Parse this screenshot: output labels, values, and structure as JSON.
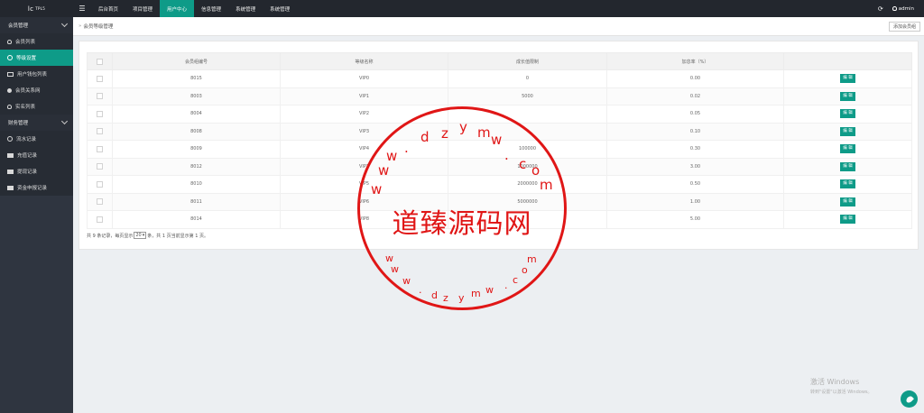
{
  "app": {
    "logo": "lc",
    "logo_sup": "TPL5"
  },
  "topnav": {
    "items": [
      "后台首页",
      "项目管理",
      "用户中心",
      "信息管理",
      "系统管理",
      "系统管理"
    ],
    "active_index": 2,
    "user": "admin"
  },
  "sidebar": {
    "groups": [
      {
        "label": "会员管理",
        "items": [
          {
            "label": "会员列表",
            "icon": "user-icon"
          },
          {
            "label": "等级设置",
            "icon": "gear-icon",
            "active": true
          },
          {
            "label": "用户钱包列表",
            "icon": "card-icon"
          },
          {
            "label": "会员关系网",
            "icon": "people-icon"
          },
          {
            "label": "实名列表",
            "icon": "user-icon"
          }
        ]
      },
      {
        "label": "财务管理",
        "items": [
          {
            "label": "流水记录",
            "icon": "water-icon"
          },
          {
            "label": "充值记录",
            "icon": "box-icon"
          },
          {
            "label": "提现记录",
            "icon": "box-icon"
          },
          {
            "label": "资金申报记录",
            "icon": "box-icon"
          }
        ]
      }
    ]
  },
  "crumb": {
    "arrow": "»",
    "title": "会员等级管理",
    "add_button": "添加会员组"
  },
  "table": {
    "headers": [
      "会员组编号",
      "等级名称",
      "成长值限制",
      "加息率（%）"
    ],
    "rows": [
      {
        "id": "8015",
        "name": "VIP0",
        "limit": "0",
        "rate": "0.00"
      },
      {
        "id": "8003",
        "name": "VIP1",
        "limit": "5000",
        "rate": "0.02"
      },
      {
        "id": "8004",
        "name": "VIP2",
        "limit": "",
        "rate": "0.05"
      },
      {
        "id": "8008",
        "name": "VIP3",
        "limit": "",
        "rate": "0.10"
      },
      {
        "id": "8009",
        "name": "VIP4",
        "limit": "100000",
        "rate": "0.30"
      },
      {
        "id": "8012",
        "name": "VIP7",
        "limit": "1000000",
        "rate": "3.00"
      },
      {
        "id": "8010",
        "name": "VIP5",
        "limit": "2000000",
        "rate": "0.50"
      },
      {
        "id": "8011",
        "name": "VIP6",
        "limit": "5000000",
        "rate": "1.00"
      },
      {
        "id": "8014",
        "name": "VIP8",
        "limit": "",
        "rate": "5.00"
      }
    ],
    "edit_label": "编 辑"
  },
  "pager": {
    "prefix": "共 9 条记录，每页显示",
    "page_size": "20",
    "suffix": "条，共 1 页当前显示第 1 页。"
  },
  "stamp": {
    "center": "道臻源码网",
    "top_url": "www.dzymw.com",
    "bottom_url": "www.dzymw.com"
  },
  "windows": {
    "title": "激活 Windows",
    "subtitle": "转到\"设置\"以激活 Windows。"
  }
}
